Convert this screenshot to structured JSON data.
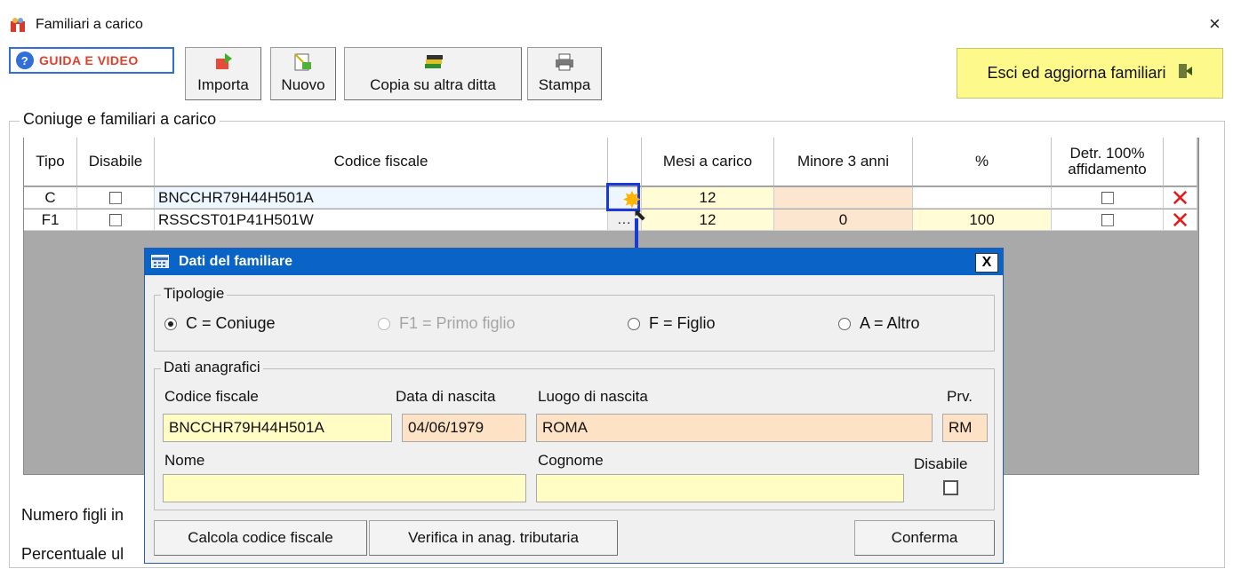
{
  "window": {
    "title": "Familiari a carico",
    "close": "×"
  },
  "guida": {
    "label": "GUIDA E VIDEO"
  },
  "toolbar": {
    "importa": "Importa",
    "nuovo": "Nuovo",
    "copia": "Copia su altra ditta",
    "stampa": "Stampa"
  },
  "esci": {
    "label": "Esci ed aggiorna familiari"
  },
  "group": {
    "legend": "Coniuge e familiari a carico"
  },
  "grid": {
    "headers": {
      "tipo": "Tipo",
      "disabile": "Disabile",
      "codice": "Codice fiscale",
      "mesi": "Mesi a carico",
      "minore": "Minore 3 anni",
      "perc": "%",
      "detr1": "Detr. 100%",
      "detr2": "affidamento"
    },
    "rows": [
      {
        "tipo": "C",
        "codice": "BNCCHR79H44H501A",
        "mesi": "12",
        "minore": "",
        "perc": ""
      },
      {
        "tipo": "F1",
        "codice": "RSSCST01P41H501W",
        "mesi": "12",
        "minore": "0",
        "perc": "100",
        "dots": "..."
      }
    ]
  },
  "bottom": {
    "numero": "Numero figli in",
    "percentuale": "Percentuale ul"
  },
  "dialog": {
    "title": "Dati del familiare",
    "close": "X",
    "tipologie": {
      "legend": "Tipologie",
      "options": [
        "C = Coniuge",
        "F1 = Primo figlio",
        "F = Figlio",
        "A = Altro"
      ]
    },
    "anagrafici": {
      "legend": "Dati anagrafici",
      "labels": {
        "codice": "Codice fiscale",
        "data": "Data di nascita",
        "luogo": "Luogo di nascita",
        "prv": "Prv.",
        "nome": "Nome",
        "cognome": "Cognome",
        "disabile": "Disabile"
      },
      "values": {
        "codice": "BNCCHR79H44H501A",
        "data": "04/06/1979",
        "luogo": "ROMA",
        "prv": "RM",
        "nome": "",
        "cognome": ""
      }
    },
    "buttons": {
      "calcola": "Calcola codice fiscale",
      "verifica": "Verifica in anag. tributaria",
      "conferma": "Conferma"
    }
  }
}
